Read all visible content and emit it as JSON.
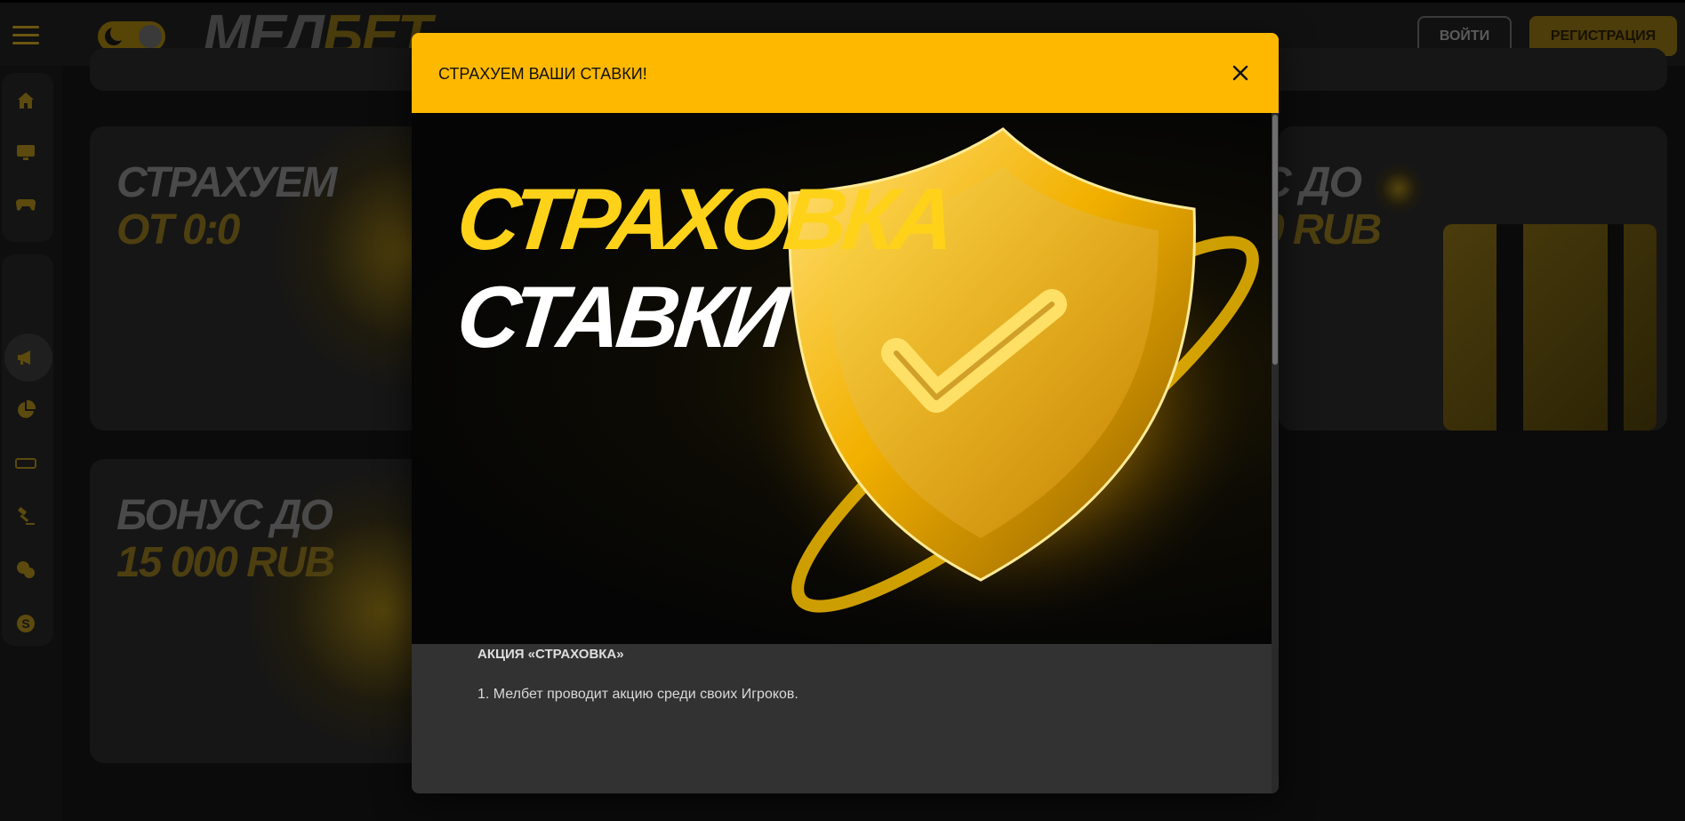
{
  "header": {
    "logo_part1": "МЕЛ",
    "logo_part2": "БЕТ",
    "login_label": "ВОЙТИ",
    "register_label": "РЕГИСТРАЦИЯ"
  },
  "sidebar": {
    "icons": [
      "home-icon",
      "live-tv-icon",
      "gamepad-icon",
      "megaphone-icon",
      "pie-chart-icon",
      "live-badge-icon",
      "auction-hammer-icon",
      "chat-icon",
      "skype-icon"
    ]
  },
  "promos": [
    {
      "line1": "СТРАХУЕМ",
      "line2": "ОТ 0:0"
    },
    {
      "line1": "С ДО",
      "line2": "0 RUB"
    },
    {
      "line1": "БОНУС ДО",
      "line2": "15 000 RUB"
    }
  ],
  "modal": {
    "title": "СТРАХУЕМ ВАШИ СТАВКИ!",
    "banner_line1": "СТРАХОВКА",
    "banner_line2": "СТАВКИ",
    "section_heading": "АКЦИЯ «СТРАХОВКА»",
    "paragraph1": "1. Мелбет проводит акцию среди своих Игроков."
  },
  "colors": {
    "accent": "#ffb800",
    "modal_bg": "#323232",
    "page_bg": "#0b0b0b"
  }
}
